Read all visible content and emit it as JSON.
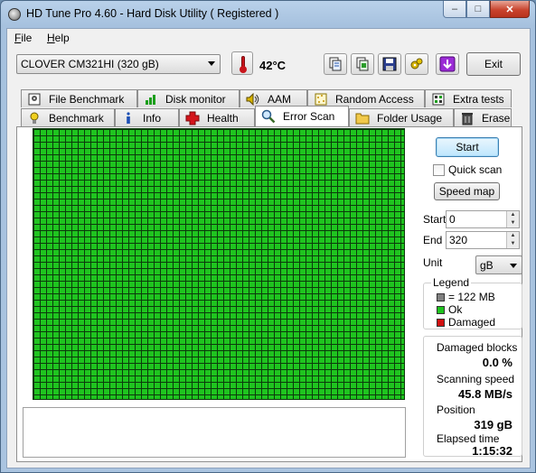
{
  "window": {
    "title": "HD Tune Pro 4.60 - Hard Disk Utility ( Registered )",
    "minimize": "–",
    "maximize": "□",
    "close": "✕"
  },
  "menu": {
    "file": "File",
    "help": "Help"
  },
  "toolbar": {
    "drive": "CLOVER  CM321HI (320 gB)",
    "temperature": "42°C",
    "exit_label": "Exit",
    "icons": [
      "copy-info-icon",
      "copy-screenshot-icon",
      "save-icon",
      "options-icon",
      "download-icon"
    ]
  },
  "tabs_top": [
    "File Benchmark",
    "Disk monitor",
    "AAM",
    "Random Access",
    "Extra tests"
  ],
  "tabs_bottom": [
    "Benchmark",
    "Info",
    "Health",
    "Error Scan",
    "Folder Usage",
    "Erase"
  ],
  "active_tab": "Error Scan",
  "scan": {
    "start_button": "Start",
    "quick_scan_label": "Quick scan",
    "quick_scan_checked": false,
    "speed_map_button": "Speed map",
    "start_label": "Start",
    "start_value": "0",
    "end_label": "End",
    "end_value": "320",
    "unit_label": "Unit",
    "unit_value": "gB",
    "grid_color": "#1fc41f"
  },
  "legend": {
    "title": "Legend",
    "block": "= 122 MB",
    "ok": "Ok",
    "damaged": "Damaged",
    "colors": {
      "block": "#808080",
      "ok": "#1fc41f",
      "damaged": "#d01010"
    }
  },
  "stats": {
    "damaged_blocks_label": "Damaged blocks",
    "damaged_blocks_value": "0.0 %",
    "scanning_speed_label": "Scanning speed",
    "scanning_speed_value": "45.8 MB/s",
    "position_label": "Position",
    "position_value": "319 gB",
    "elapsed_label": "Elapsed time",
    "elapsed_value": "1:15:32"
  }
}
